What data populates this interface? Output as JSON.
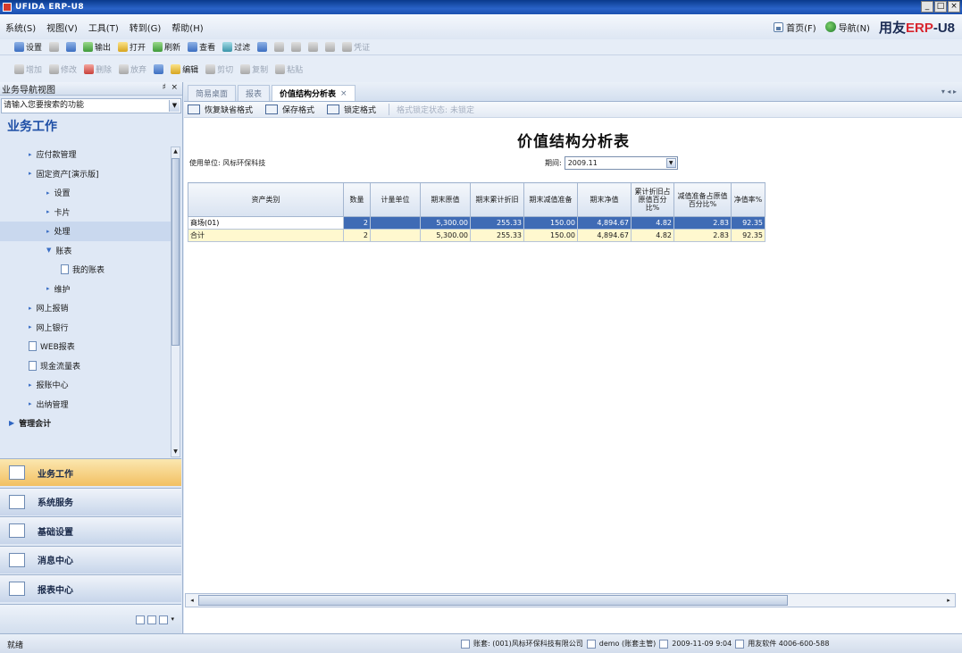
{
  "window": {
    "title": "UFIDA ERP-U8",
    "controls": [
      "_",
      "□",
      "×"
    ]
  },
  "menu": {
    "items": [
      "系统(S)",
      "视图(V)",
      "工具(T)",
      "转到(G)",
      "帮助(H)"
    ],
    "right": {
      "home": "首页(F)",
      "nav": "导航(N)",
      "brand_prefix": "用友",
      "brand_erp": "ERP",
      "brand_suffix": "-U8"
    }
  },
  "toolbar1": [
    {
      "label": "设置",
      "icon": "settings-icon",
      "enabled": true
    },
    {
      "label": "",
      "icon": "print-icon",
      "enabled": true
    },
    {
      "label": "",
      "icon": "preview-icon",
      "enabled": true
    },
    {
      "label": "输出",
      "icon": "output-icon",
      "enabled": true
    },
    {
      "label": "打开",
      "icon": "open-folder-icon",
      "enabled": true
    },
    {
      "label": "刷新",
      "icon": "refresh-icon",
      "enabled": true
    },
    {
      "label": "查看",
      "icon": "view-icon",
      "enabled": true
    },
    {
      "label": "过滤",
      "icon": "filter-icon",
      "enabled": true
    },
    {
      "label": "",
      "icon": "help-icon",
      "enabled": true
    },
    {
      "label": "",
      "icon": "first-icon",
      "enabled": false
    },
    {
      "label": "",
      "icon": "prev-icon",
      "enabled": false
    },
    {
      "label": "",
      "icon": "next-icon",
      "enabled": false
    },
    {
      "label": "",
      "icon": "last-icon",
      "enabled": false
    },
    {
      "label": "凭证",
      "icon": "voucher-icon",
      "enabled": false
    }
  ],
  "toolbar2": [
    {
      "label": "增加",
      "icon": "add-icon",
      "enabled": false
    },
    {
      "label": "修改",
      "icon": "edit-icon",
      "enabled": false
    },
    {
      "label": "删除",
      "icon": "delete-icon",
      "enabled": false
    },
    {
      "label": "放弃",
      "icon": "discard-icon",
      "enabled": false
    },
    {
      "label": "",
      "icon": "save-icon",
      "enabled": false
    },
    {
      "label": "编辑",
      "icon": "editor-icon",
      "enabled": true
    },
    {
      "label": "剪切",
      "icon": "cut-icon",
      "enabled": false
    },
    {
      "label": "复制",
      "icon": "copy-icon",
      "enabled": false
    },
    {
      "label": "粘贴",
      "icon": "paste-icon",
      "enabled": false
    }
  ],
  "left_panel": {
    "header": "业务导航视图",
    "pin": "♯",
    "close": "×",
    "search_placeholder": "请输入您要搜索的功能",
    "section_title": "业务工作",
    "tree": [
      {
        "label": "应付款管理",
        "type": "bullet",
        "indent": 32
      },
      {
        "label": "固定资产[演示版]",
        "type": "bullet",
        "indent": 32
      },
      {
        "label": "设置",
        "type": "bullet",
        "indent": 52
      },
      {
        "label": "卡片",
        "type": "bullet",
        "indent": 52
      },
      {
        "label": "处理",
        "type": "bullet",
        "indent": 52,
        "selected": true
      },
      {
        "label": "账表",
        "type": "open",
        "indent": 52
      },
      {
        "label": "我的账表",
        "type": "doc",
        "indent": 68
      },
      {
        "label": "维护",
        "type": "bullet",
        "indent": 52
      },
      {
        "label": "网上报销",
        "type": "bullet",
        "indent": 32
      },
      {
        "label": "网上银行",
        "type": "bullet",
        "indent": 32
      },
      {
        "label": "WEB报表",
        "type": "doc",
        "indent": 32
      },
      {
        "label": "现金流量表",
        "type": "doc",
        "indent": 32
      },
      {
        "label": "报账中心",
        "type": "bullet",
        "indent": 32
      },
      {
        "label": "出纳管理",
        "type": "bullet",
        "indent": 32
      },
      {
        "label": "管理会计",
        "type": "group",
        "indent": 10
      }
    ],
    "nav_buttons": [
      "业务工作",
      "系统服务",
      "基础设置",
      "消息中心",
      "报表中心"
    ]
  },
  "main": {
    "tabs": [
      {
        "label": "简易桌面",
        "active": false
      },
      {
        "label": "报表",
        "active": false
      },
      {
        "label": "价值结构分析表",
        "active": true
      }
    ],
    "tab_close": "×",
    "tab_nav": "▾ ◂ ▸",
    "report_toolbar": [
      {
        "label": "恢复缺省格式",
        "enabled": true
      },
      {
        "label": "保存格式",
        "enabled": true
      },
      {
        "label": "锁定格式",
        "enabled": true
      },
      {
        "label": "格式锁定状态: 未锁定",
        "enabled": false
      }
    ],
    "report": {
      "title": "价值结构分析表",
      "unit_label": "使用单位: 风标环保科技",
      "period_label": "期间:",
      "period_value": "2009.11",
      "columns": [
        "资产类别",
        "数量",
        "计量单位",
        "期末原值",
        "期末累计折旧",
        "期末减值准备",
        "期末净值",
        "累计折旧占原值百分比%",
        "减值准备占原值百分比%",
        "净值率%"
      ],
      "rows": [
        {
          "type": "sel",
          "cells": [
            "商场(01)",
            "2",
            "",
            "5,300.00",
            "255.33",
            "150.00",
            "4,894.67",
            "4.82",
            "2.83",
            "92.35"
          ]
        },
        {
          "type": "tot",
          "cells": [
            "合计",
            "2",
            "",
            "5,300.00",
            "255.33",
            "150.00",
            "4,894.67",
            "4.82",
            "2.83",
            "92.35"
          ]
        }
      ]
    }
  },
  "status": {
    "ready": "就绪",
    "account": "账套: (001)风标环保科技有限公司",
    "user": "demo (账套主管)",
    "datetime": "2009-11-09 9:04",
    "vendor": "用友软件 4006-600-588"
  }
}
